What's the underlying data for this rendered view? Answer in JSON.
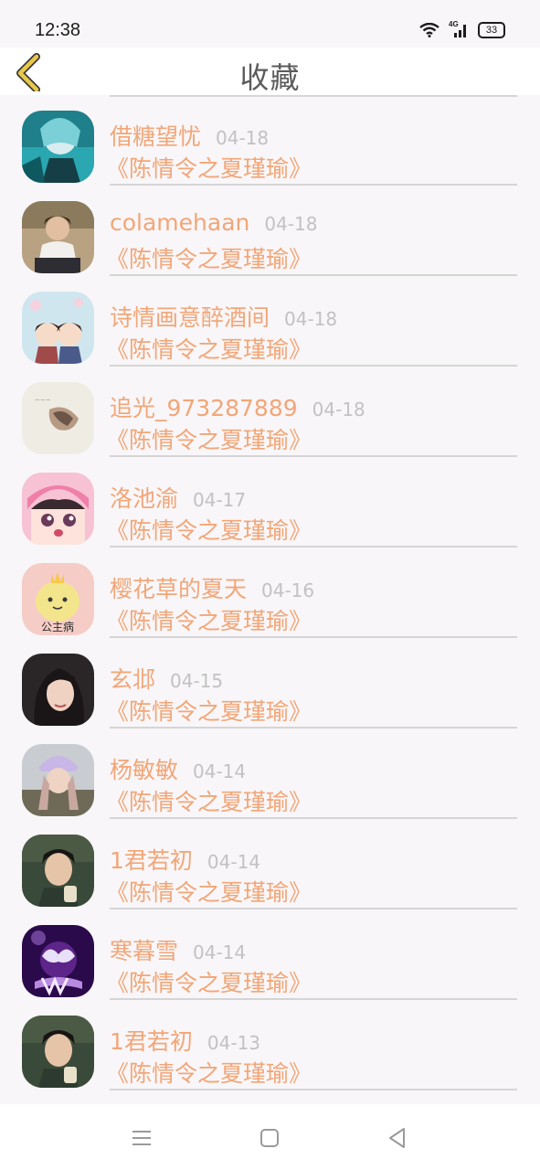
{
  "status": {
    "time": "12:38",
    "network": "4G",
    "battery": "33"
  },
  "header": {
    "title": "收藏"
  },
  "favorites": [
    {
      "name": "借糖望忧",
      "date": "04-18",
      "book": "《陈情令之夏瑾瑜》"
    },
    {
      "name": "colamehaan",
      "date": "04-18",
      "book": "《陈情令之夏瑾瑜》"
    },
    {
      "name": "诗情画意醉酒间",
      "date": "04-18",
      "book": "《陈情令之夏瑾瑜》"
    },
    {
      "name": "追光_973287889",
      "date": "04-18",
      "book": "《陈情令之夏瑾瑜》"
    },
    {
      "name": "洛池渝",
      "date": "04-17",
      "book": "《陈情令之夏瑾瑜》"
    },
    {
      "name": "樱花草的夏天",
      "date": "04-16",
      "book": "《陈情令之夏瑾瑜》"
    },
    {
      "name": "玄邶",
      "date": "04-15",
      "book": "《陈情令之夏瑾瑜》"
    },
    {
      "name": "杨敏敏",
      "date": "04-14",
      "book": "《陈情令之夏瑾瑜》"
    },
    {
      "name": "1君若初",
      "date": "04-14",
      "book": "《陈情令之夏瑾瑜》"
    },
    {
      "name": "寒暮雪",
      "date": "04-14",
      "book": "《陈情令之夏瑾瑜》"
    },
    {
      "name": "1君若初",
      "date": "04-13",
      "book": "《陈情令之夏瑾瑜》"
    }
  ],
  "avatar_art": [
    {
      "label": ""
    },
    {
      "label": ""
    },
    {
      "label": ""
    },
    {
      "label": ""
    },
    {
      "label": ""
    },
    {
      "label": "公主病"
    },
    {
      "label": ""
    },
    {
      "label": ""
    },
    {
      "label": ""
    },
    {
      "label": ""
    },
    {
      "label": ""
    }
  ],
  "colors": {
    "accent": "#f2a678",
    "date": "#c2c2c2",
    "title": "#5b5b5b",
    "back": "#e8c84a"
  }
}
